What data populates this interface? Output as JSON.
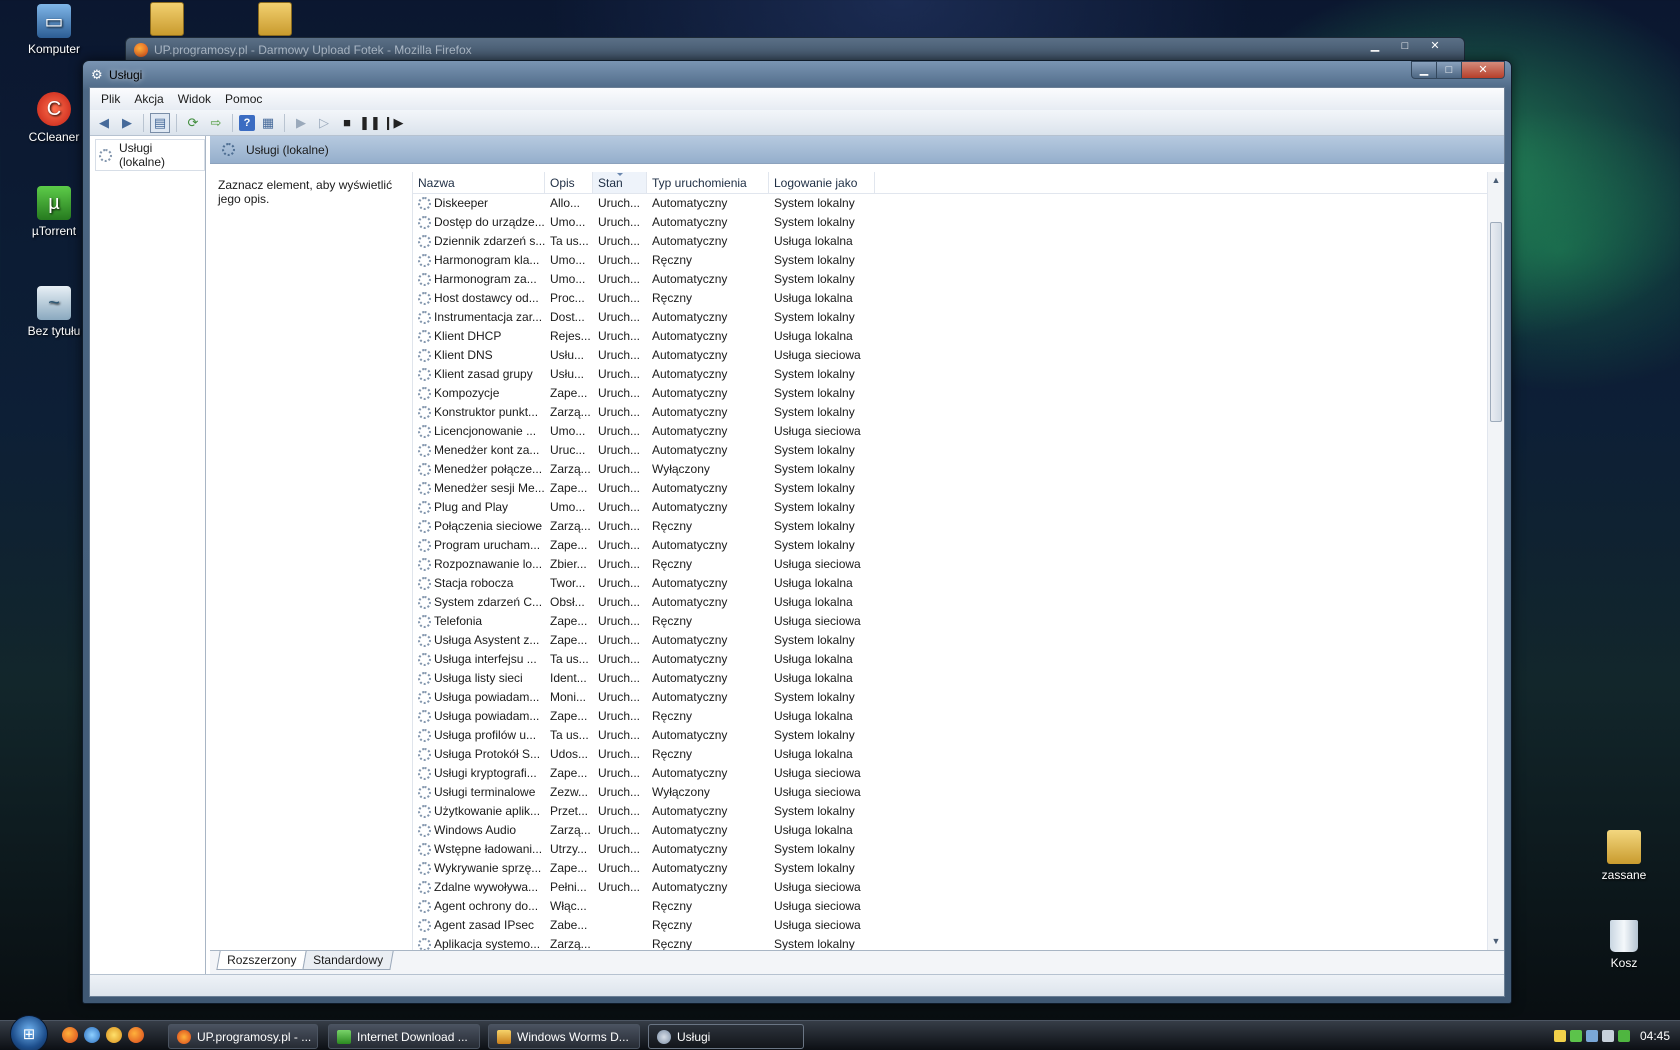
{
  "desktop": {
    "icons_left": [
      {
        "label": "Komputer",
        "icon": "computer-icon"
      },
      {
        "label": "CCleaner",
        "icon": "ccleaner-icon"
      },
      {
        "label": "µTorrent",
        "icon": "utorrent-icon"
      },
      {
        "label": "Bez tytułu",
        "icon": "image-file-icon"
      }
    ],
    "icons_right": [
      {
        "label": "zassane",
        "icon": "folder-shortcut-icon"
      },
      {
        "label": "Kosz",
        "icon": "recycle-bin-icon"
      }
    ]
  },
  "background_window": {
    "title": "UP.programosy.pl - Darmowy Upload Fotek - Mozilla Firefox",
    "controls": [
      "▁",
      "□",
      "✕"
    ]
  },
  "window": {
    "title": "Usługi",
    "controls": {
      "minimize": "▁",
      "maximize": "□",
      "close": "✕"
    },
    "menu": [
      "Plik",
      "Akcja",
      "Widok",
      "Pomoc"
    ],
    "tree_root": "Usługi (lokalne)",
    "content_title": "Usługi (lokalne)",
    "description_hint": "Zaznacz element, aby wyświetlić jego opis.",
    "columns": [
      "Nazwa",
      "Opis",
      "Stan",
      "Typ uruchomienia",
      "Logowanie jako"
    ],
    "services": [
      [
        "Diskeeper",
        "Allo...",
        "Uruch...",
        "Automatyczny",
        "System lokalny"
      ],
      [
        "Dostęp do urządze...",
        "Umo...",
        "Uruch...",
        "Automatyczny",
        "System lokalny"
      ],
      [
        "Dziennik zdarzeń s...",
        "Ta us...",
        "Uruch...",
        "Automatyczny",
        "Usługa lokalna"
      ],
      [
        "Harmonogram kla...",
        "Umo...",
        "Uruch...",
        "Ręczny",
        "System lokalny"
      ],
      [
        "Harmonogram za...",
        "Umo...",
        "Uruch...",
        "Automatyczny",
        "System lokalny"
      ],
      [
        "Host dostawcy od...",
        "Proc...",
        "Uruch...",
        "Ręczny",
        "Usługa lokalna"
      ],
      [
        "Instrumentacja zar...",
        "Dost...",
        "Uruch...",
        "Automatyczny",
        "System lokalny"
      ],
      [
        "Klient DHCP",
        "Rejes...",
        "Uruch...",
        "Automatyczny",
        "Usługa lokalna"
      ],
      [
        "Klient DNS",
        "Usłu...",
        "Uruch...",
        "Automatyczny",
        "Usługa sieciowa"
      ],
      [
        "Klient zasad grupy",
        "Usłu...",
        "Uruch...",
        "Automatyczny",
        "System lokalny"
      ],
      [
        "Kompozycje",
        "Zape...",
        "Uruch...",
        "Automatyczny",
        "System lokalny"
      ],
      [
        "Konstruktor punkt...",
        "Zarzą...",
        "Uruch...",
        "Automatyczny",
        "System lokalny"
      ],
      [
        "Licencjonowanie ...",
        "Umo...",
        "Uruch...",
        "Automatyczny",
        "Usługa sieciowa"
      ],
      [
        "Menedżer kont za...",
        "Uruc...",
        "Uruch...",
        "Automatyczny",
        "System lokalny"
      ],
      [
        "Menedżer połącze...",
        "Zarzą...",
        "Uruch...",
        "Wyłączony",
        "System lokalny"
      ],
      [
        "Menedżer sesji Me...",
        "Zape...",
        "Uruch...",
        "Automatyczny",
        "System lokalny"
      ],
      [
        "Plug and Play",
        "Umo...",
        "Uruch...",
        "Automatyczny",
        "System lokalny"
      ],
      [
        "Połączenia sieciowe",
        "Zarzą...",
        "Uruch...",
        "Ręczny",
        "System lokalny"
      ],
      [
        "Program urucham...",
        "Zape...",
        "Uruch...",
        "Automatyczny",
        "System lokalny"
      ],
      [
        "Rozpoznawanie lo...",
        "Zbier...",
        "Uruch...",
        "Ręczny",
        "Usługa sieciowa"
      ],
      [
        "Stacja robocza",
        "Twor...",
        "Uruch...",
        "Automatyczny",
        "Usługa lokalna"
      ],
      [
        "System zdarzeń C...",
        "Obsł...",
        "Uruch...",
        "Automatyczny",
        "Usługa lokalna"
      ],
      [
        "Telefonia",
        "Zape...",
        "Uruch...",
        "Ręczny",
        "Usługa sieciowa"
      ],
      [
        "Usługa Asystent z...",
        "Zape...",
        "Uruch...",
        "Automatyczny",
        "System lokalny"
      ],
      [
        "Usługa interfejsu ...",
        "Ta us...",
        "Uruch...",
        "Automatyczny",
        "Usługa lokalna"
      ],
      [
        "Usługa listy sieci",
        "Ident...",
        "Uruch...",
        "Automatyczny",
        "Usługa lokalna"
      ],
      [
        "Usługa powiadam...",
        "Moni...",
        "Uruch...",
        "Automatyczny",
        "System lokalny"
      ],
      [
        "Usługa powiadam...",
        "Zape...",
        "Uruch...",
        "Ręczny",
        "Usługa lokalna"
      ],
      [
        "Usługa profilów u...",
        "Ta us...",
        "Uruch...",
        "Automatyczny",
        "System lokalny"
      ],
      [
        "Usługa Protokół S...",
        "Udos...",
        "Uruch...",
        "Ręczny",
        "Usługa lokalna"
      ],
      [
        "Usługi kryptografi...",
        "Zape...",
        "Uruch...",
        "Automatyczny",
        "Usługa sieciowa"
      ],
      [
        "Usługi terminalowe",
        "Zezw...",
        "Uruch...",
        "Wyłączony",
        "Usługa sieciowa"
      ],
      [
        "Użytkowanie aplik...",
        "Przet...",
        "Uruch...",
        "Automatyczny",
        "System lokalny"
      ],
      [
        "Windows Audio",
        "Zarzą...",
        "Uruch...",
        "Automatyczny",
        "Usługa lokalna"
      ],
      [
        "Wstępne ładowani...",
        "Utrzy...",
        "Uruch...",
        "Automatyczny",
        "System lokalny"
      ],
      [
        "Wykrywanie sprzę...",
        "Zape...",
        "Uruch...",
        "Automatyczny",
        "System lokalny"
      ],
      [
        "Zdalne wywoływa...",
        "Pełni...",
        "Uruch...",
        "Automatyczny",
        "Usługa sieciowa"
      ],
      [
        "Agent ochrony do...",
        "Włąc...",
        "",
        "Ręczny",
        "Usługa sieciowa"
      ],
      [
        "Agent zasad IPsec",
        "Zabe...",
        "",
        "Ręczny",
        "Usługa sieciowa"
      ],
      [
        "Aplikacja systemo...",
        "Zarzą...",
        "",
        "Ręczny",
        "System lokalny"
      ]
    ],
    "tabs": [
      "Rozszerzony",
      "Standardowy"
    ]
  },
  "taskbar": {
    "tasks": [
      {
        "label": "UP.programosy.pl - ...",
        "icon": "firefox-icon"
      },
      {
        "label": "Internet Download ...",
        "icon": "download-icon"
      },
      {
        "label": "Windows Worms D...",
        "icon": "shield-icon"
      },
      {
        "label": "Usługi",
        "icon": "gear-icon"
      }
    ],
    "clock": "04:45"
  }
}
